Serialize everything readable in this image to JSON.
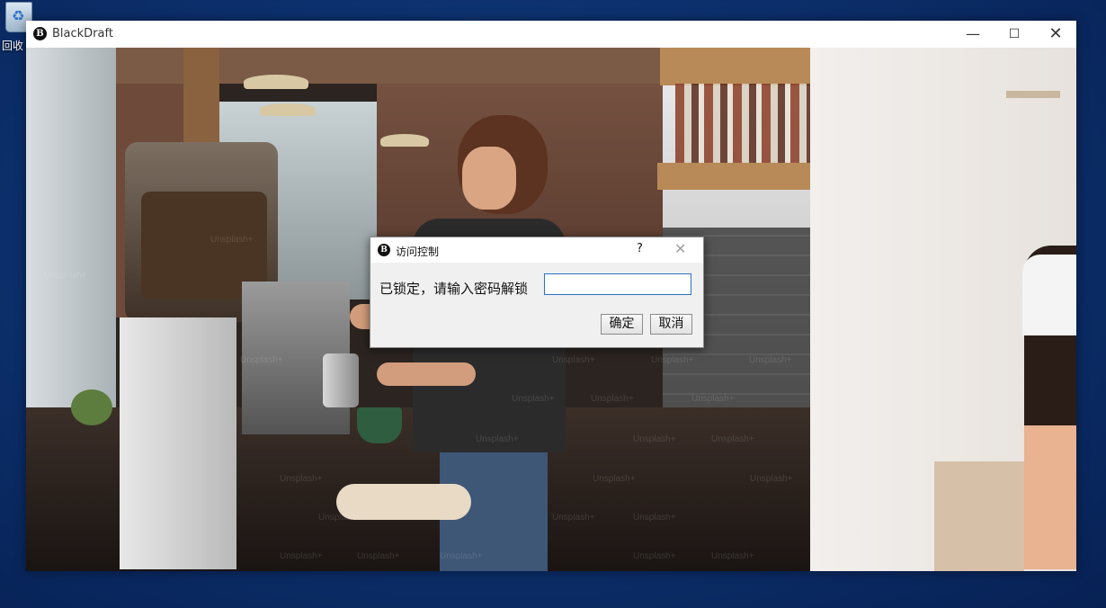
{
  "desktop": {
    "recycle_bin_label": "回收"
  },
  "window": {
    "title": "BlackDraft",
    "icon_letter": "B",
    "buttons": {
      "minimize": "—",
      "maximize": "☐",
      "close": "✕"
    }
  },
  "background": {
    "watermark_text": "Unsplash+"
  },
  "dialog": {
    "icon_letter": "B",
    "title": "访问控制",
    "help": "?",
    "close": "✕",
    "prompt": "已锁定，请输入密码解锁",
    "password_value": "",
    "ok_label": "确定",
    "cancel_label": "取消"
  },
  "colors": {
    "desktop": "#0d3270",
    "dialog_bg": "#f0f0f0",
    "input_border": "#2a72c6"
  }
}
